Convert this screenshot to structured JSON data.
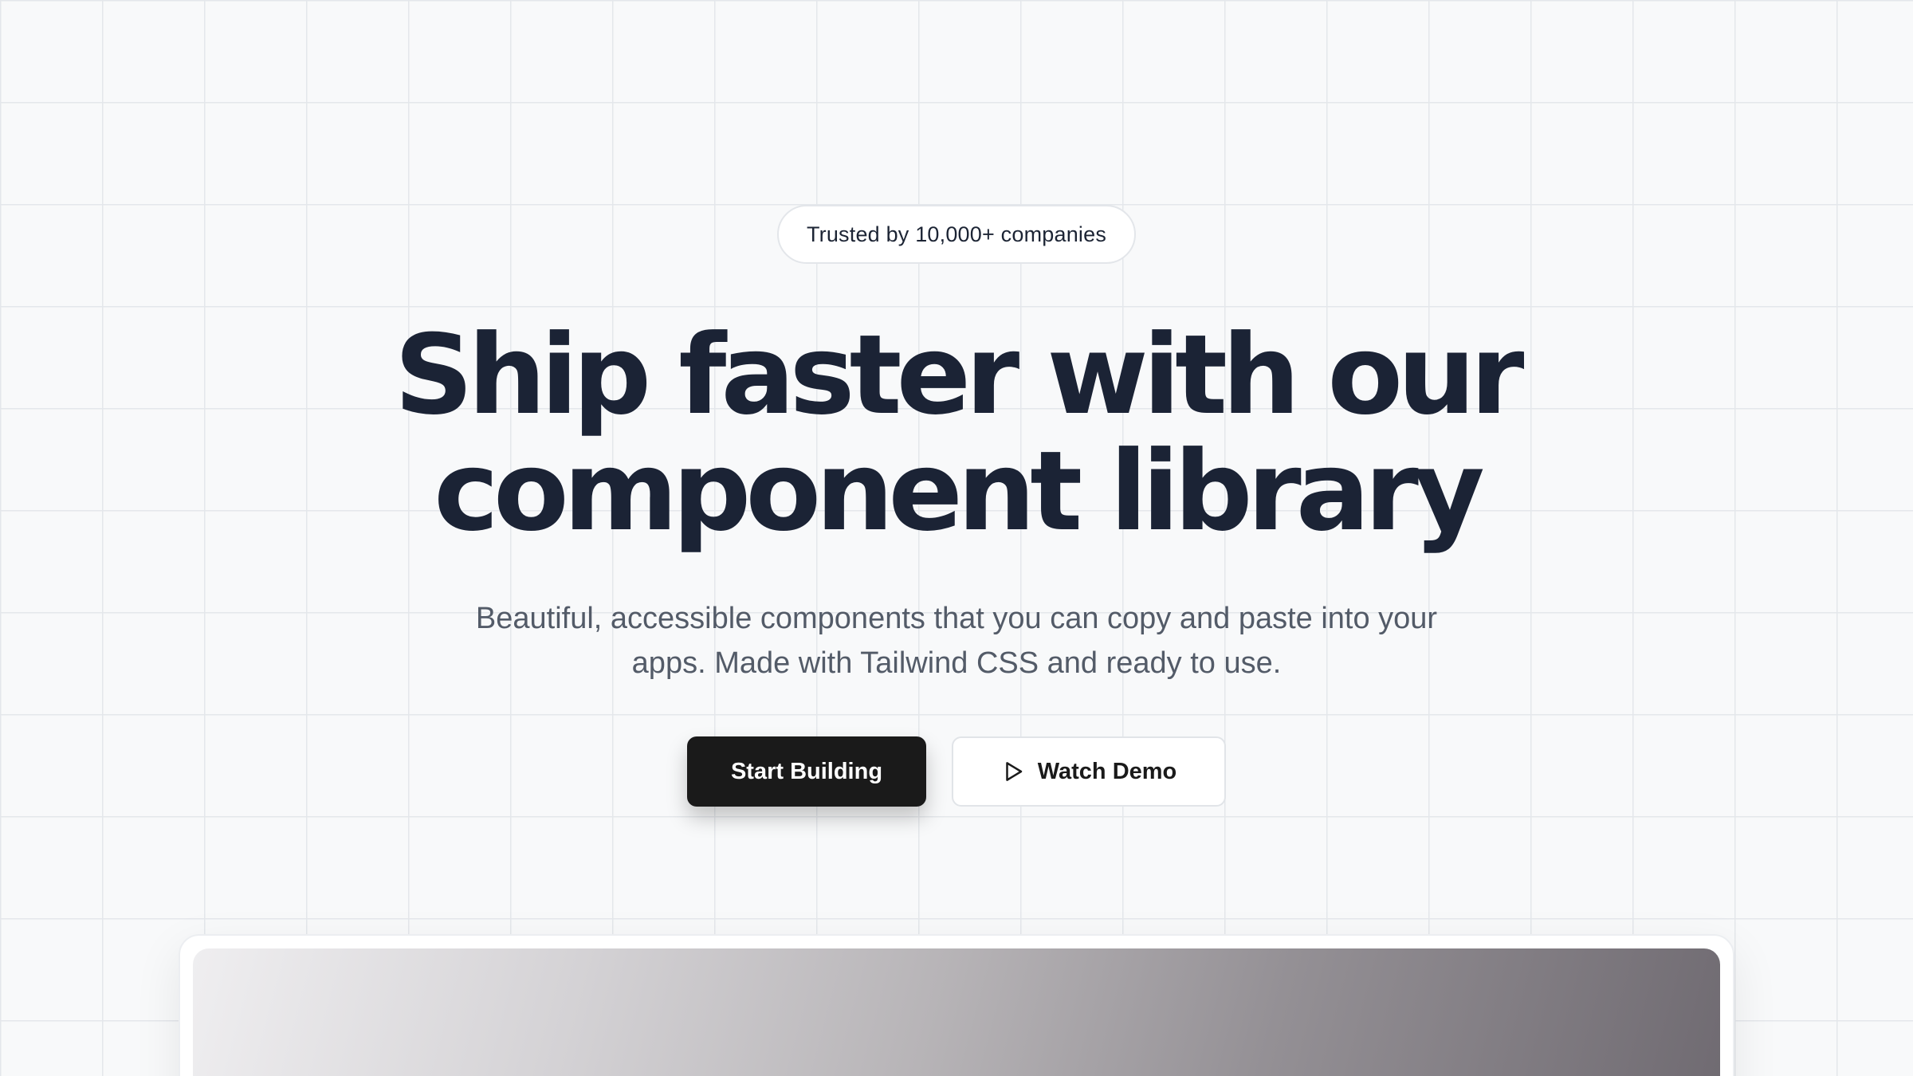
{
  "hero": {
    "badge_text": "Trusted by 10,000+ companies",
    "headline_line1": "Ship faster with our",
    "headline_line2": "component library",
    "subtitle_line1": "Beautiful, accessible components that you can copy and paste into your",
    "subtitle_line2": "apps. Made with Tailwind CSS and ready to use.",
    "primary_cta_label": "Start Building",
    "secondary_cta_label": "Watch Demo",
    "secondary_cta_icon": "play-icon"
  },
  "colors": {
    "background": "#f8f9fa",
    "grid_line": "#e4e7eb",
    "headline": "#1b2335",
    "subtitle": "#535b68",
    "primary_button": "#1a1a1a",
    "secondary_button": "#ffffff"
  }
}
